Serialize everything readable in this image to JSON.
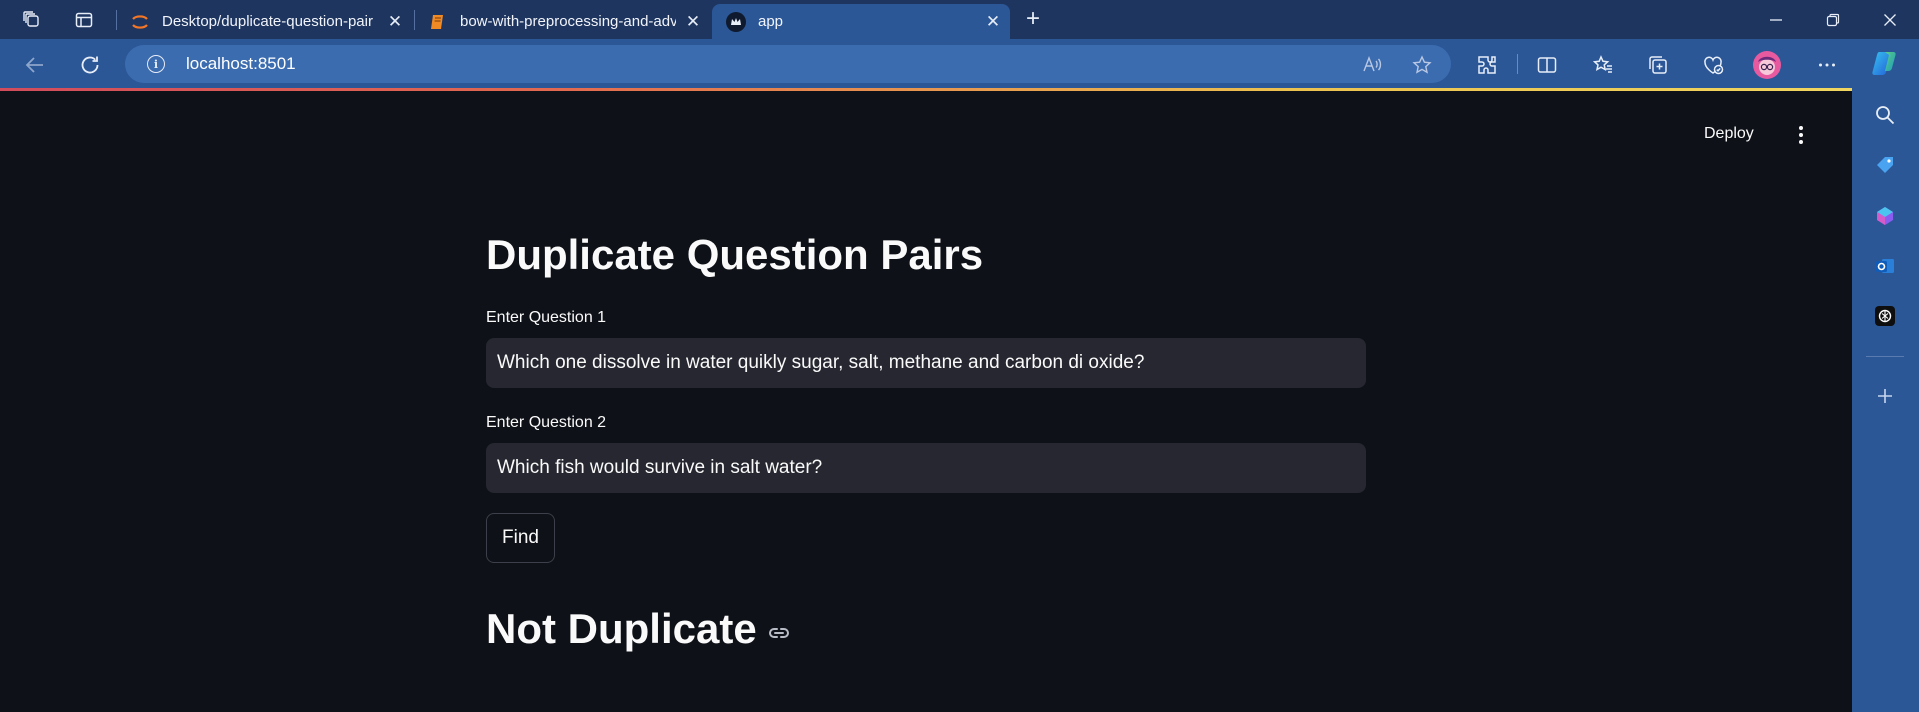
{
  "browser": {
    "tabs": [
      {
        "title": "Desktop/duplicate-question-pair",
        "favicon": "jupyter-icon",
        "active": false
      },
      {
        "title": "bow-with-preprocessing-and-adv",
        "favicon": "notebook-icon",
        "active": false
      },
      {
        "title": "app",
        "favicon": "streamlit-crown-icon",
        "active": true
      }
    ],
    "tab_close_glyph": "✕",
    "new_tab_glyph": "+",
    "url": "localhost:8501",
    "accent_colors": {
      "tabstrip": "#1e3560",
      "toolbar": "#2b5797",
      "omnibox": "#3c6cb0"
    }
  },
  "app": {
    "header": {
      "deploy_label": "Deploy"
    },
    "title": "Duplicate Question Pairs",
    "question1": {
      "label": "Enter Question 1",
      "value": "Which one dissolve in water quikly sugar, salt, methane and carbon di oxide?"
    },
    "question2": {
      "label": "Enter Question 2",
      "value": "Which fish would survive in salt water?"
    },
    "find_button_label": "Find",
    "result_text": "Not Duplicate",
    "colors": {
      "background": "#0e1117",
      "input_bg": "#262730",
      "text": "#fafafa"
    }
  }
}
